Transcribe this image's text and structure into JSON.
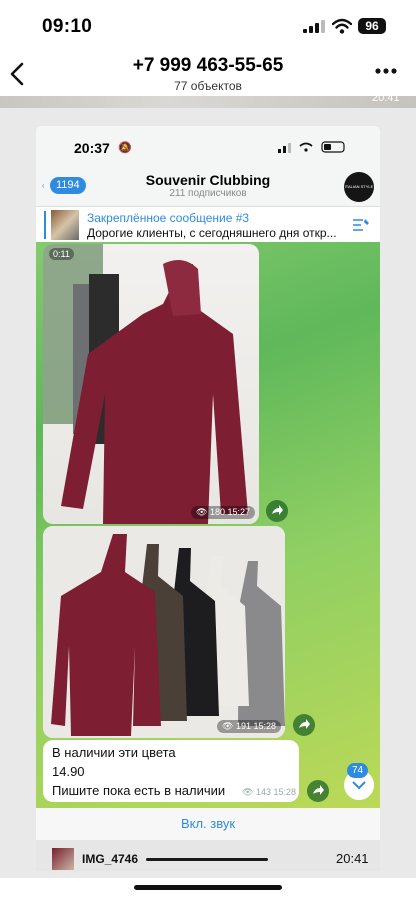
{
  "status_bar": {
    "time": "09:10",
    "battery": "96"
  },
  "header": {
    "title": "+7 999 463-55-65",
    "subtitle": "77 объектов"
  },
  "top_strip_time": "20:41",
  "inner": {
    "status_time": "20:37",
    "back_count": "1194",
    "channel_name": "Souvenir Clubbing",
    "channel_subtitle": "211 подписчиков",
    "avatar_text": "ITALIAN STYLE",
    "pinned": {
      "title": "Закреплённое сообщение #3",
      "text": "Дорогие клиенты, с сегодняшнего дня откр..."
    },
    "post1": {
      "duration": "0:11",
      "views": "180",
      "time": "15:27"
    },
    "post2": {
      "views": "191",
      "time": "15:28"
    },
    "text_post": {
      "line1": "В наличии эти цвета",
      "line2": "14.90",
      "line3": "Пишите пока есть в наличии",
      "views": "143",
      "time": "15:28"
    },
    "unread_count": "74",
    "sound_button": "Вкл. звук"
  },
  "video_bar": {
    "file_name": "IMG_4746",
    "time": "20:41"
  },
  "colors": {
    "accent": "#2f8be0",
    "shirt_burgundy": "#7d1e33"
  }
}
